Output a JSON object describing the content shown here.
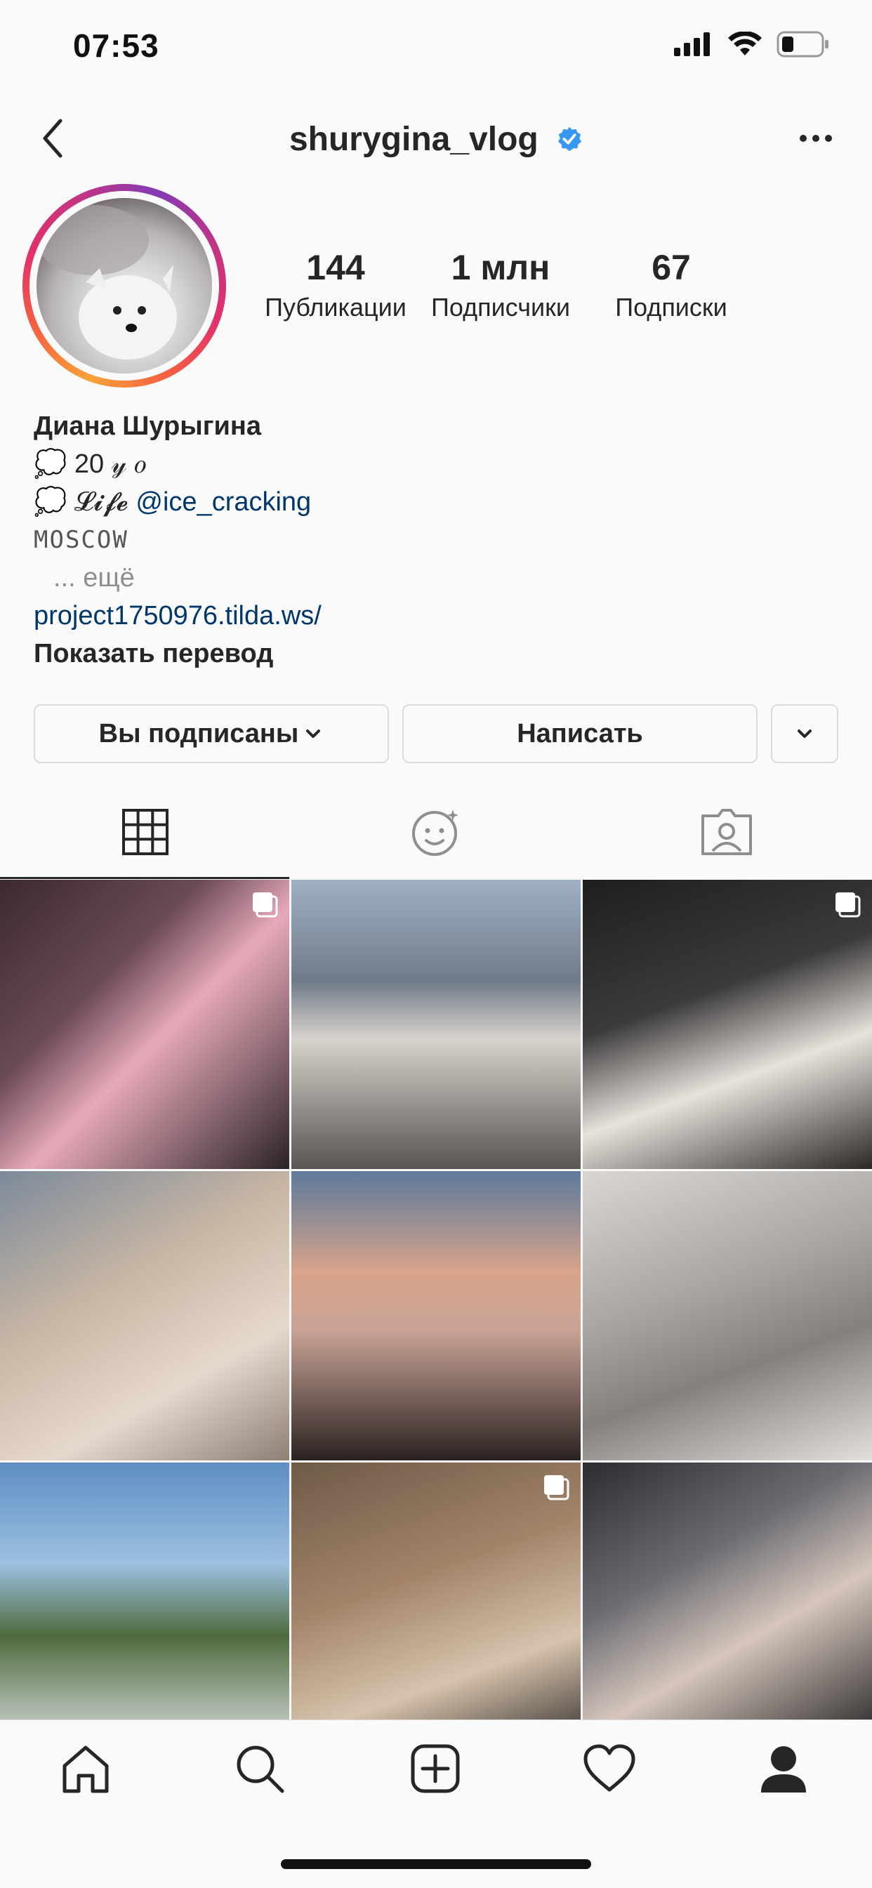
{
  "status_bar": {
    "time": "07:53"
  },
  "header": {
    "username": "shurygina_vlog",
    "verified_icon": "verified-badge-icon",
    "back_icon": "chevron-left-icon",
    "more_icon": "more-horizontal-icon"
  },
  "profile": {
    "stats": [
      {
        "value": "144",
        "label": "Публикации"
      },
      {
        "value": "1 млн",
        "label": "Подписчики"
      },
      {
        "value": "67",
        "label": "Подписки"
      }
    ]
  },
  "bio": {
    "name": "Диана Шурыгина",
    "line1_emoji": "💭",
    "line1_text": "20 𝓎 𝑜",
    "line2_emoji": "💭",
    "line2_text": "𝓛𝓲𝓯𝓮",
    "line2_mention": "@ice_cracking",
    "line3": "MOSCOW",
    "more": "... ещё",
    "link": "project1750976.tilda.ws/",
    "translate": "Показать перевод"
  },
  "buttons": {
    "following": "Вы подписаны",
    "message": "Написать"
  },
  "tabs": [
    "grid-icon",
    "tagged-effects-icon",
    "tagged-user-icon"
  ],
  "posts": [
    {
      "multi": true,
      "bg": "linear-gradient(135deg,#3b2a2e 0%,#6a4a55 35%,#e7a9b9 55%,#2a2326 100%)"
    },
    {
      "multi": false,
      "bg": "linear-gradient(180deg,#9fb0c4 0%,#6f7b88 35%,#d8d2cc 55%,#5a5452 100%)"
    },
    {
      "multi": true,
      "bg": "linear-gradient(160deg,#1e1e20 0%,#3c3a3b 40%,#e8e2dc 65%,#2b2826 100%)"
    },
    {
      "multi": false,
      "bg": "linear-gradient(150deg,#7d8a9a 0%,#c9b7a5 40%,#e6d8cc 70%,#8e7f74 100%)"
    },
    {
      "multi": false,
      "bg": "linear-gradient(180deg,#5c7a9c 0%,#d8a48a 35%,#c9a396 55%,#2a2220 100%)"
    },
    {
      "multi": false,
      "bg": "linear-gradient(160deg,#d9d6d4 0%,#a9a6a4 40%,#85807c 65%,#e2dfdc 100%)"
    },
    {
      "multi": false,
      "bg": "linear-gradient(180deg,#5e8ec4 0%,#9cc0e0 35%,#4f6b3d 60%,#dfe2e6 100%)"
    },
    {
      "multi": true,
      "bg": "linear-gradient(160deg,#6f5a46 0%,#a2836a 40%,#d7c3ac 70%,#2e2a28 100%)"
    },
    {
      "multi": false,
      "bg": "linear-gradient(150deg,#2c2c30 0%,#6b6b72 35%,#d6c6bc 60%,#1d1d1f 100%)"
    }
  ],
  "bottom_nav": [
    "home-icon",
    "search-icon",
    "new-post-icon",
    "activity-heart-icon",
    "profile-icon"
  ]
}
